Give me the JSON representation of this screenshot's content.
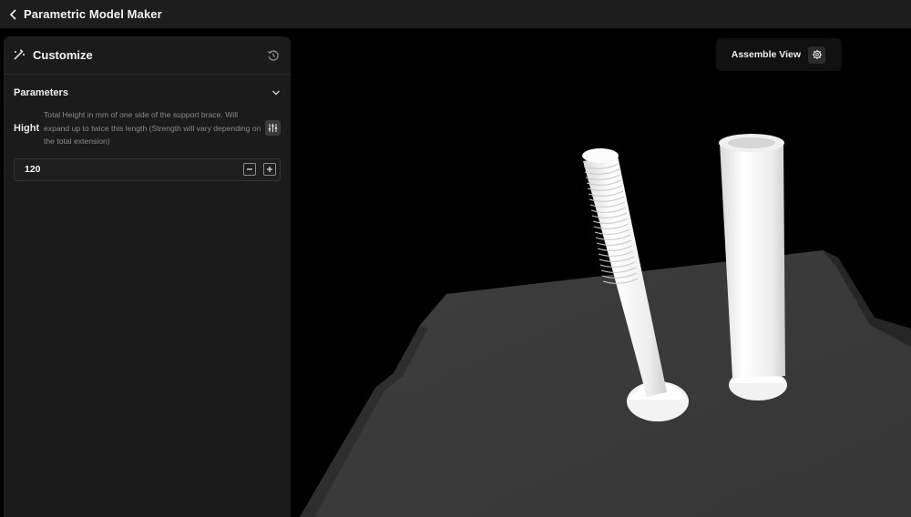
{
  "app": {
    "title": "Parametric Model Maker"
  },
  "panel": {
    "title": "Customize",
    "section": {
      "title": "Parameters"
    },
    "parameter": {
      "name": "Hight",
      "description": "Total Height in mm of one side of the support brace. Will expand up to twice this length (Strength will vary depending on the total extension)",
      "value": "120"
    }
  },
  "viewport": {
    "assemble_label": "Assemble View",
    "icons": [
      "chevron-left-icon",
      "wand-icon",
      "history-icon",
      "chevron-down-icon",
      "sliders-icon",
      "minus-icon",
      "plus-icon",
      "gear-icon"
    ],
    "colors": {
      "panel": "#1b1b1b",
      "topbar": "#1d1d1d",
      "platform": "#3a3a3a",
      "model": "#f4f4f4"
    }
  }
}
